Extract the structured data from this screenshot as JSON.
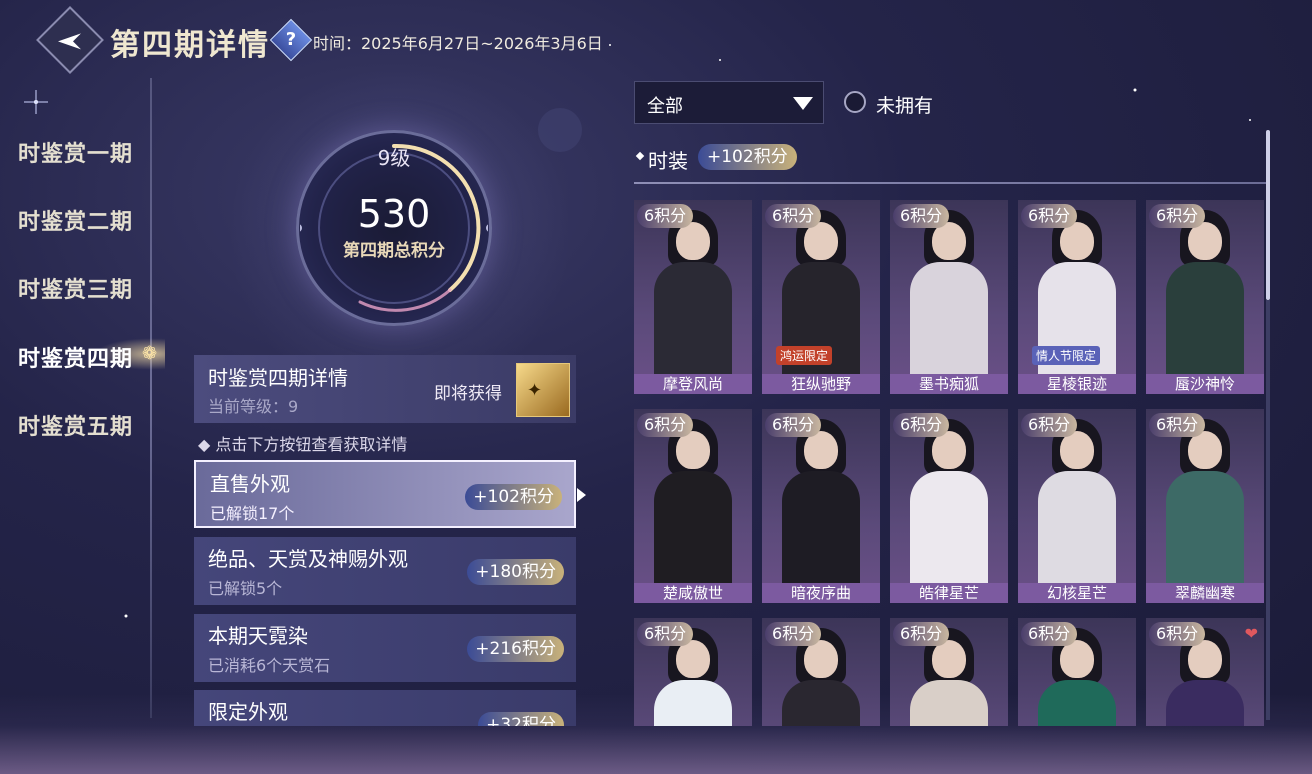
{
  "header": {
    "title": "第四期详情",
    "time_label": "时间：2025年6月27日~2026年3月6日"
  },
  "sidebar": {
    "items": [
      {
        "label": "时鉴赏一期"
      },
      {
        "label": "时鉴赏二期"
      },
      {
        "label": "时鉴赏三期"
      },
      {
        "label": "时鉴赏四期"
      },
      {
        "label": "时鉴赏五期"
      }
    ],
    "active_index": 3
  },
  "score": {
    "level": "9级",
    "total": "530",
    "label": "第四期总积分"
  },
  "detail": {
    "title": "时鉴赏四期详情",
    "current_level": "当前等级：9",
    "soon_label": "即将获得"
  },
  "hint": "◆ 点击下方按钮查看获取详情",
  "categories": [
    {
      "title": "直售外观",
      "sub": "已解锁17个",
      "points": "+102积分"
    },
    {
      "title": "绝品、天赏及神赐外观",
      "sub": "已解锁5个",
      "points": "+180积分"
    },
    {
      "title": "本期天霓染",
      "sub": "已消耗6个天赏石",
      "points": "+216积分"
    },
    {
      "title": "限定外观",
      "sub": "",
      "points": "+32积分"
    }
  ],
  "filter": {
    "selected": "全部",
    "radio_label": "未拥有"
  },
  "section": {
    "title": "时装",
    "points": "+102积分"
  },
  "items": [
    {
      "points": "6积分",
      "name": "摩登风尚",
      "badge": ""
    },
    {
      "points": "6积分",
      "name": "狂纵驰野",
      "badge": "鸿运限定"
    },
    {
      "points": "6积分",
      "name": "墨书痴狐",
      "badge": ""
    },
    {
      "points": "6积分",
      "name": "星棱银迹",
      "badge": "情人节限定"
    },
    {
      "points": "6积分",
      "name": "蜃沙神怜",
      "badge": ""
    },
    {
      "points": "6积分",
      "name": "楚咸傲世",
      "badge": ""
    },
    {
      "points": "6积分",
      "name": "暗夜序曲",
      "badge": ""
    },
    {
      "points": "6积分",
      "name": "皓律星芒",
      "badge": ""
    },
    {
      "points": "6积分",
      "name": "幻核星芒",
      "badge": ""
    },
    {
      "points": "6积分",
      "name": "翠麟幽寒",
      "badge": ""
    },
    {
      "points": "6积分",
      "name": "",
      "badge": ""
    },
    {
      "points": "6积分",
      "name": "",
      "badge": ""
    },
    {
      "points": "6积分",
      "name": "",
      "badge": ""
    },
    {
      "points": "6积分",
      "name": "",
      "badge": ""
    },
    {
      "points": "6积分",
      "name": "",
      "badge": ""
    }
  ],
  "colors": {
    "accent": "#c9b27a",
    "card_name_bg": "#7c5aa0",
    "points_pill": "#3b4b96"
  }
}
